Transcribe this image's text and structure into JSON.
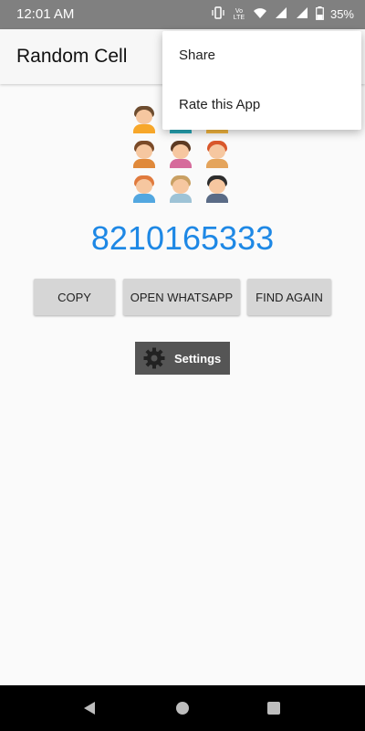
{
  "status_bar": {
    "time": "12:01 AM",
    "battery": "35%",
    "volte": "Vo LTE"
  },
  "app_bar": {
    "title": "Random Cell"
  },
  "overflow_menu": {
    "items": [
      "Share",
      "Rate this App"
    ]
  },
  "avatars": {
    "count": 9
  },
  "main": {
    "phone_number": "8210165333",
    "buttons": {
      "copy": "COPY",
      "open_whatsapp": "OPEN WHATSAPP",
      "find_again": "FIND AGAIN"
    },
    "settings_label": "Settings"
  },
  "colors": {
    "accent": "#1e88e5",
    "status_bar": "#808080",
    "button": "#d6d6d6",
    "settings_button": "#555555",
    "nav_bar": "#000000"
  }
}
